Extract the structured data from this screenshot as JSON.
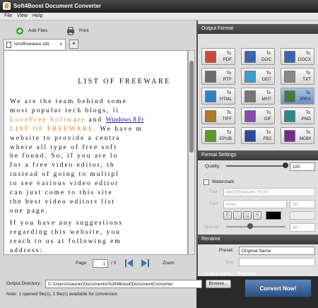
{
  "window": {
    "title": "Soft4Boost Document Converter"
  },
  "menu": [
    "File",
    "View",
    "Help"
  ],
  "toolbar": {
    "add_files": "Add Files",
    "print": "Print"
  },
  "tab": {
    "name": "listoffreeware.odt",
    "close": "x",
    "add": "+"
  },
  "document": {
    "title": "LIST OF FREEWARE",
    "p1": [
      "We are the team behind some",
      "most popular tech blogs, li",
      "LoveFree Software",
      "and",
      "Windows 8 Fr",
      "LIST OF FREEWARE.",
      "We have m",
      "website to provide a centra",
      "where all type of free soft",
      "be found. So, if you are lo",
      "for a free video editor, th",
      "instead of going to multipl",
      "to see various video editor",
      "can just come to this site",
      "the best video editors list",
      "one page."
    ],
    "p2": [
      "If you have any suggestions",
      "regarding this website, you",
      "reach to us at following em",
      "address:"
    ]
  },
  "pager": {
    "page_label": "Page",
    "page_value": "1",
    "total": "/ 3",
    "zoom_label": "Zoom",
    "first_icon": "first-page-icon",
    "next_icon": "next-page-icon"
  },
  "output_format": {
    "header": "Output Format",
    "to": "To",
    "formats": [
      "PDF",
      "DOC",
      "DOCX",
      "RTF",
      "ODT",
      "TXT",
      "HTML",
      "MHT",
      "JPEG",
      "TIFF",
      "GIF",
      "PNG",
      "EPUB",
      "FB2",
      "MOBI"
    ],
    "selected": "JPEG"
  },
  "format_settings": {
    "header": "Format Settings",
    "quality_label": "Quality:",
    "quality_value": "100",
    "quality_level": 1.0,
    "watermark_label": "Watermark",
    "text_label": "Text",
    "text_placeholder": "WATERMARK TEXT",
    "font_label": "Font",
    "font_value": "Arial",
    "font_size": "36",
    "bold": "B",
    "italic": "I",
    "underline": "U",
    "strike": "S",
    "opacity_label": "Opacity",
    "opacity_value": "40",
    "opacity_level": 0.4
  },
  "rename": {
    "header": "Rename",
    "preset_label": "Preset:",
    "preset_value": "Original Name",
    "text_label": "Text",
    "output_name_label": "Output Name:",
    "output_name_value": "Example"
  },
  "output": {
    "dir_label": "Output Directory:",
    "dir_value": "C:\\Users\\Gaurav\\Documents\\Soft4Boost\\DocumentConverter",
    "browse": "Browse...",
    "convert": "Convert Now!",
    "note": "Note: 1 opened file(s), 1 file(s) available for conversion"
  },
  "colors": {
    "accent": "#2c4f80",
    "selected": "#6f93c8",
    "link_orange": "#e8812a"
  }
}
